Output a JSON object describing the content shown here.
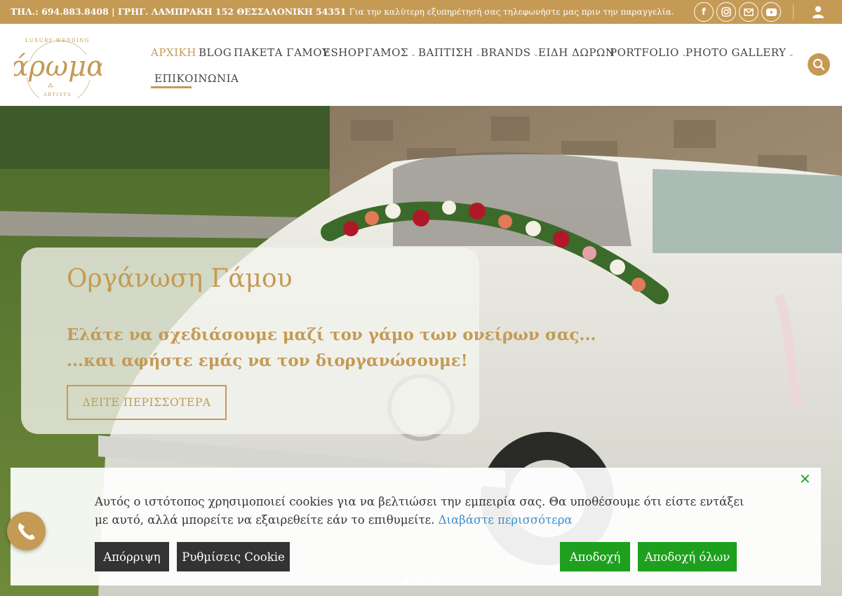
{
  "topbar": {
    "contact_bold": "ΤΗΛ.: 694.883.8408 | ΓΡΗΓ. ΛΑΜΠΡΑΚΗ 152 ΘΕΣΣΑΛΟΝΙΚΗ 54351",
    "contact_note": "Για την καλύτερη εξυπηρέτησή σας τηλεφωνήστε μας πριν την παραγγελία.",
    "social_icons": [
      "facebook-icon",
      "instagram-icon",
      "email-icon",
      "youtube-icon"
    ],
    "account_icon": "user-icon"
  },
  "header": {
    "logo_text": "άρωμα",
    "logo_top": "LUXURY WEDDING",
    "logo_bottom": "ARTISTS",
    "nav": [
      {
        "label": "ΑΡΧΙΚΗ",
        "active": true
      },
      {
        "label": "BLOG"
      },
      {
        "label": "ΠΑΚΕΤΑ ΓΑΜΟΥ"
      },
      {
        "label": "ESHOP"
      },
      {
        "label": "ΓΑΜΟΣ",
        "dropdown": true
      },
      {
        "label": "ΒΑΠΤΙΣΗ",
        "dropdown": true
      },
      {
        "label": "BRANDS",
        "dropdown": true
      },
      {
        "label": "ΕΙΔΗ ΔΩΡΩΝ"
      },
      {
        "label": "PORTFOLIO",
        "dropdown": true
      },
      {
        "label": "PHOTO GALLERY",
        "dropdown": true
      },
      {
        "label": "ΕΠΙΚΟΙΝΩΝΙΑ"
      }
    ],
    "search_icon": "search-icon"
  },
  "hero": {
    "title": "Οργάνωση Γάμου",
    "subtitle_line1": "Ελάτε να σχεδιάσουμε μαζί τον γάμο των ονείρων σας...",
    "subtitle_line2": "...και αφήστε εμάς να τον διοργανώσουμε!",
    "button": "ΔΕΙΤΕ ΠΕΡΙΣΣΟΤΕΡΑ"
  },
  "cookie": {
    "text": "Αυτός ο ιστότοπος χρησιμοποιεί cookies για να βελτιώσει την εμπειρία σας. Θα υποθέσουμε ότι είστε εντάξει με αυτό, αλλά μπορείτε να εξαιρεθείτε εάν το επιθυμείτε.",
    "more_link": "Διαβάστε περισσότερα",
    "reject": "Απόρριψη",
    "settings": "Ρυθμίσεις Cookie",
    "accept": "Αποδοχή",
    "accept_all": "Αποδοχή όλων",
    "close_icon": "close-icon"
  },
  "colors": {
    "brand_gold": "#c49a55",
    "accept_green": "#1ea01e",
    "link_blue": "#3a8fd0",
    "dark_button": "#333333"
  }
}
